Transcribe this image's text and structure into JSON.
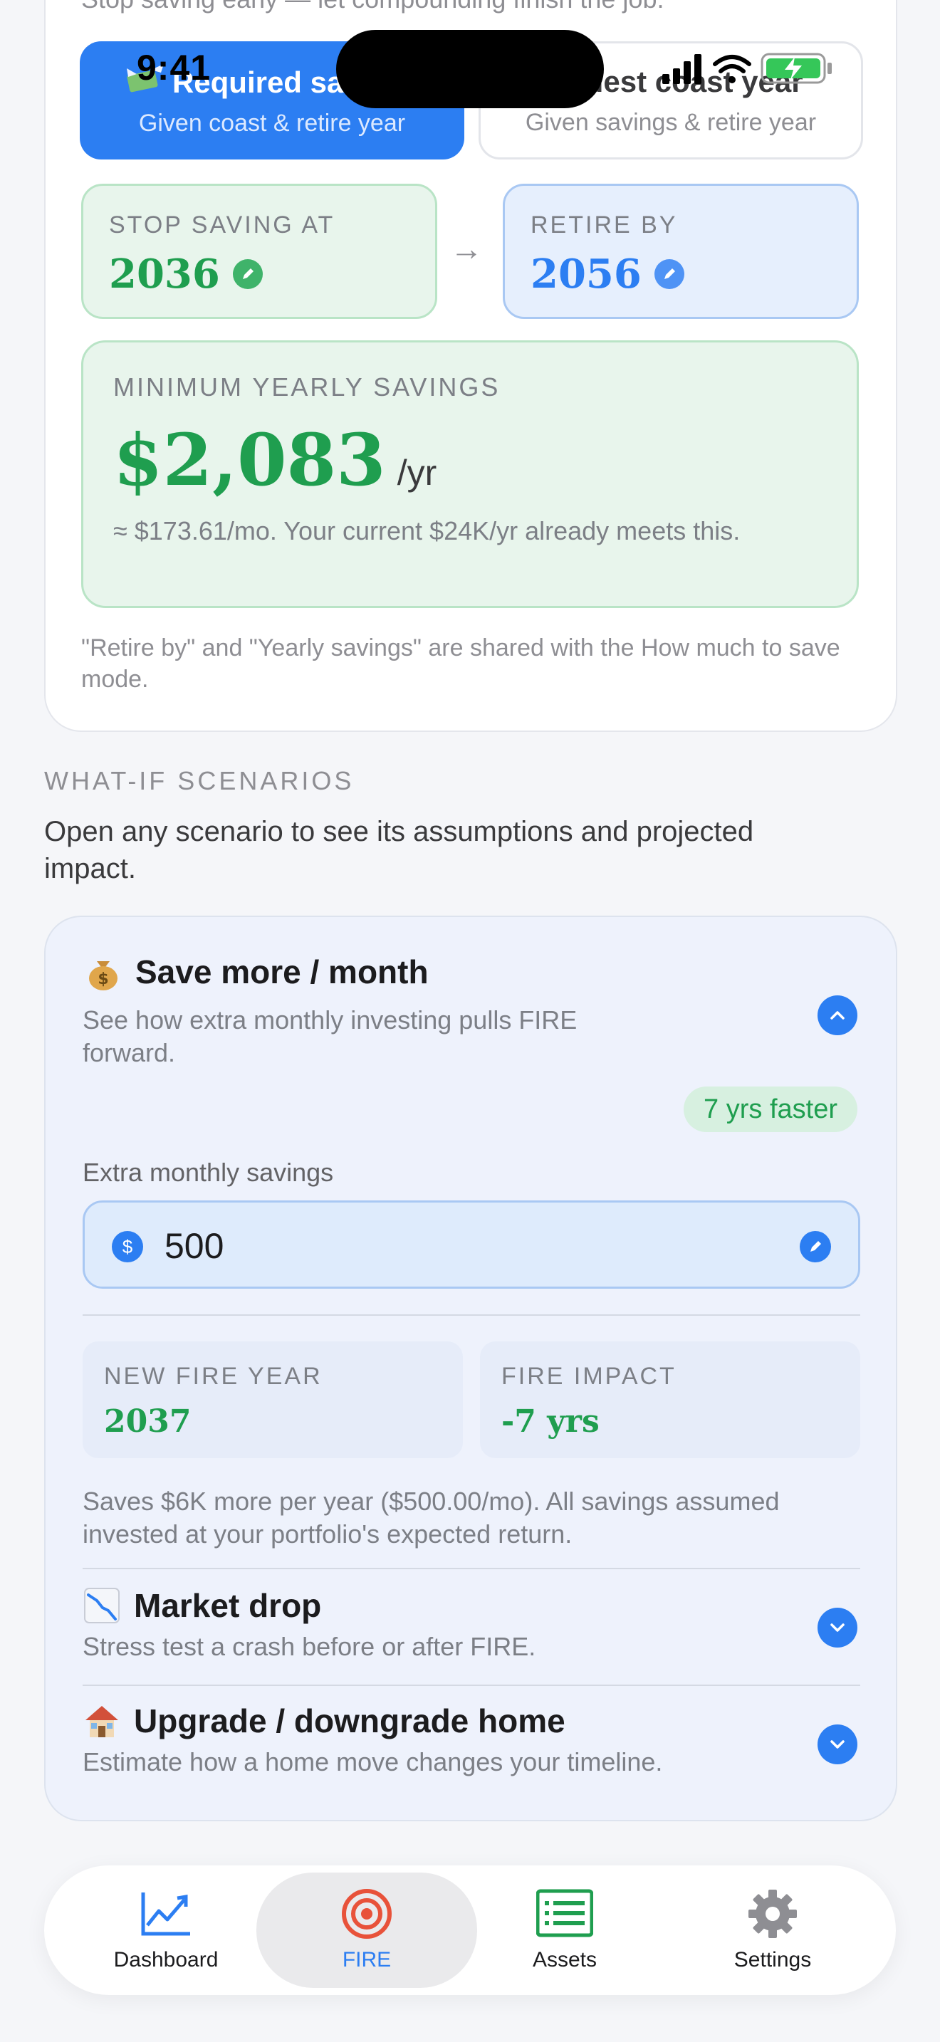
{
  "status_bar": {
    "time": "9:41"
  },
  "top_card": {
    "subtitle": "Stop saving early — let compounding finish the job.",
    "modes": [
      {
        "title": "Required savings",
        "subtitle": "Given coast & retire year",
        "icon": "money-with-wings-icon"
      },
      {
        "title": "Earliest coast year",
        "subtitle": "Given savings & retire year"
      }
    ],
    "stop_saving": {
      "label": "STOP SAVING AT",
      "value": "2036"
    },
    "retire_by": {
      "label": "RETIRE BY",
      "value": "2056"
    },
    "min_savings": {
      "label": "MINIMUM YEARLY SAVINGS",
      "value": "$2,083",
      "unit": "/yr",
      "note": "≈ $173.61/mo. Your current $24K/yr already meets this."
    },
    "footnote": "\"Retire by\" and \"Yearly savings\" are shared with the How much to save mode."
  },
  "whatif": {
    "title": "WHAT-IF SCENARIOS",
    "description": "Open any scenario to see its assumptions and projected impact.",
    "scenarios": [
      {
        "icon": "money-bag-icon",
        "title": "Save more / month",
        "description": "See how extra monthly investing pulls FIRE forward.",
        "badge": "7 yrs faster",
        "field_label": "Extra monthly savings",
        "field_value": "500",
        "new_fire_label": "NEW FIRE YEAR",
        "new_fire_value": "2037",
        "impact_label": "FIRE IMPACT",
        "impact_value": "-7 yrs",
        "note": "Saves $6K more per year ($500.00/mo). All savings assumed invested at your portfolio's expected return."
      },
      {
        "icon": "chart-decreasing-icon",
        "title": "Market drop",
        "description": "Stress test a crash before or after FIRE."
      },
      {
        "icon": "house-icon",
        "title": "Upgrade / downgrade home",
        "description": "Estimate how a home move changes your timeline."
      }
    ]
  },
  "tabs": [
    {
      "label": "Dashboard",
      "icon": "chart-line-icon"
    },
    {
      "label": "FIRE",
      "icon": "target-icon",
      "active": true
    },
    {
      "label": "Assets",
      "icon": "list-icon"
    },
    {
      "label": "Settings",
      "icon": "gear-icon"
    }
  ],
  "colors": {
    "accent": "#2c7ef2",
    "success": "#1f9e4f",
    "fire_icon": "#e8523a"
  }
}
